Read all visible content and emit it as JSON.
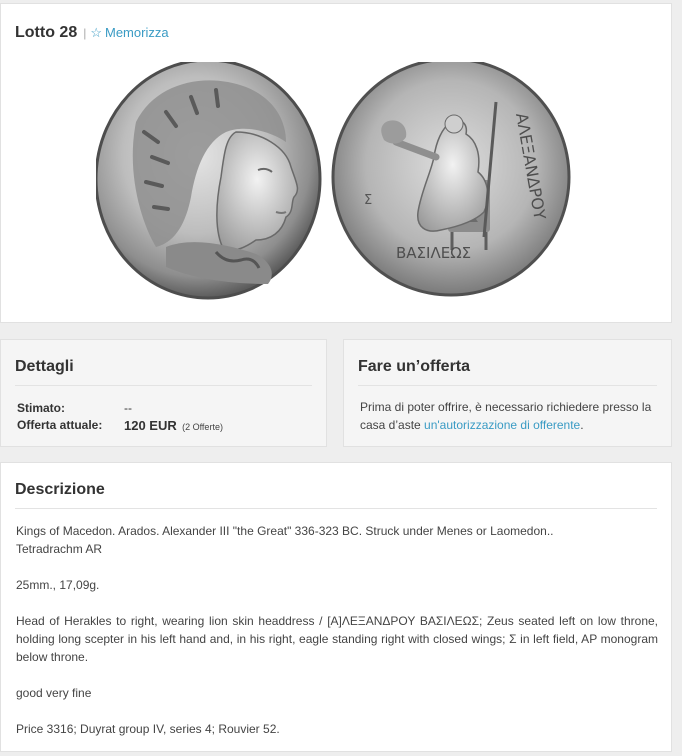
{
  "lot": {
    "title": "Lotto 28",
    "separator": "|",
    "memorize_label": "Memorizza",
    "star_icon": "star-outline-icon"
  },
  "images": {
    "obverse": "Silver tetradrachm obverse: head of Herakles right in lion skin headdress",
    "reverse": "Silver tetradrachm reverse: Zeus seated left on throne holding eagle and scepter",
    "reverse_legend_right": "ΑΛΕΞΑΝΔΡΟΥ",
    "reverse_legend_bottom": "ΒΑΣΙΛΕΩΣ",
    "reverse_field_mark": "Σ"
  },
  "details": {
    "heading": "Dettagli",
    "estimate_label": "Stimato:",
    "estimate_value": "--",
    "current_bid_label": "Offerta attuale:",
    "current_bid_value": "120 EUR",
    "current_bid_count": "(2 Offerte)"
  },
  "offer": {
    "heading": "Fare un’offerta",
    "text_before_link": "Prima di poter offrire, è necessario richiedere presso la casa d’aste ",
    "link_text": "un'autorizzazione di offerente",
    "text_after_link": "."
  },
  "description": {
    "heading": "Descrizione",
    "line1": "Kings of Macedon. Arados. Alexander III \"the Great\" 336-323 BC. Struck under Menes or Laomedon..",
    "line2": "Tetradrachm AR",
    "size_weight": "25mm., 17,09g.",
    "details_text": "Head of Herakles to right, wearing lion skin headdress / [Α]ΛΕΞΑΝΔΡΟΥ ΒΑΣΙΛΕΩΣ; Zeus seated left on low throne, holding long scepter in his left hand and, in his right, eagle standing right with closed wings; Σ in left field, AP monogram below throne.",
    "grade": "good very fine",
    "references": "Price 3316; Duyrat group IV, series 4; Rouvier 52."
  },
  "colors": {
    "accent": "#3a9bc4",
    "page_bg": "#eeeeee",
    "card_bg": "#ffffff",
    "grey_card_bg": "#f5f5f5",
    "text": "#333333"
  }
}
